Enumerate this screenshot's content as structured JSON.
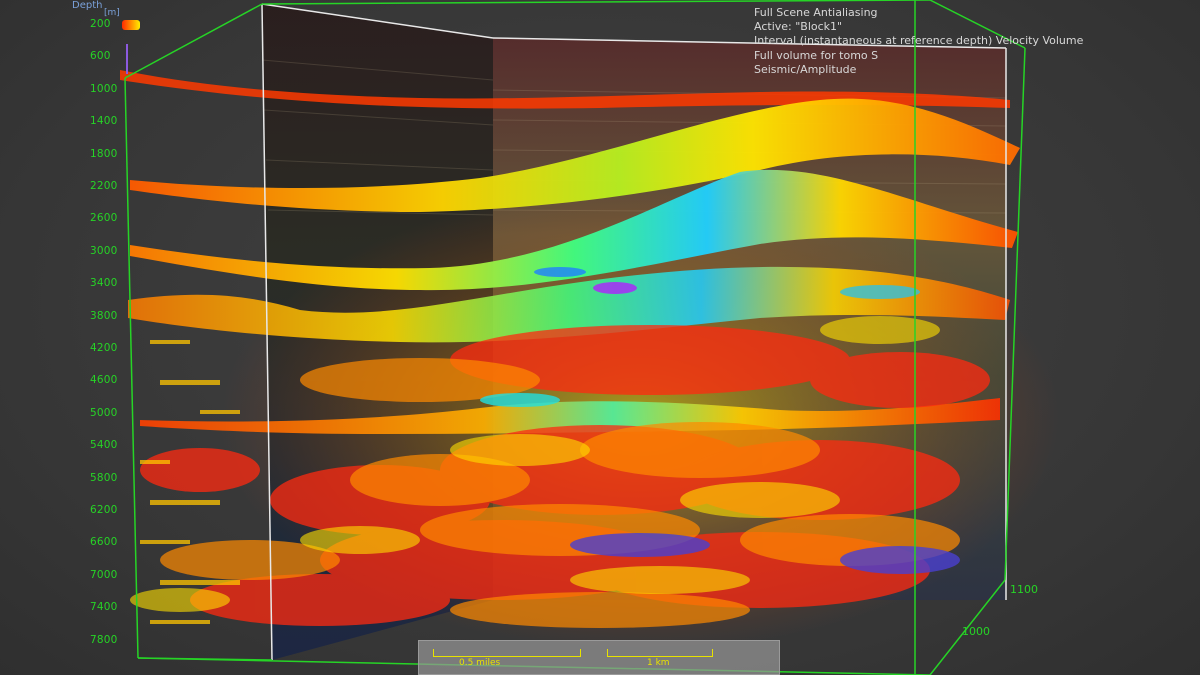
{
  "depth_axis": {
    "title": "Depth",
    "unit": "[m]",
    "ticks": [
      "200",
      "600",
      "1000",
      "1400",
      "1800",
      "2200",
      "2600",
      "3000",
      "3400",
      "3800",
      "4200",
      "4600",
      "5000",
      "5400",
      "5800",
      "6200",
      "6600",
      "7000",
      "7400",
      "7800"
    ]
  },
  "info_panel": {
    "lines": [
      "Full Scene Antialiasing",
      "Active: \"Block1\"",
      "Interval (instantaneous at reference depth) Velocity Volume",
      "Full volume for tomo S",
      "Seismic/Amplitude"
    ]
  },
  "right_axis": {
    "labels": [
      "1100",
      "1000"
    ]
  },
  "scale_bar": {
    "miles_label": "0.5 miles",
    "km_label": "1 km"
  },
  "colors": {
    "frame_green": "#26d426",
    "panel_text": "#d8d8d8",
    "scale_yellow": "#e8e200",
    "background": "#3a3a3a"
  },
  "icons": [
    "legend-swatch",
    "axis-tick"
  ]
}
